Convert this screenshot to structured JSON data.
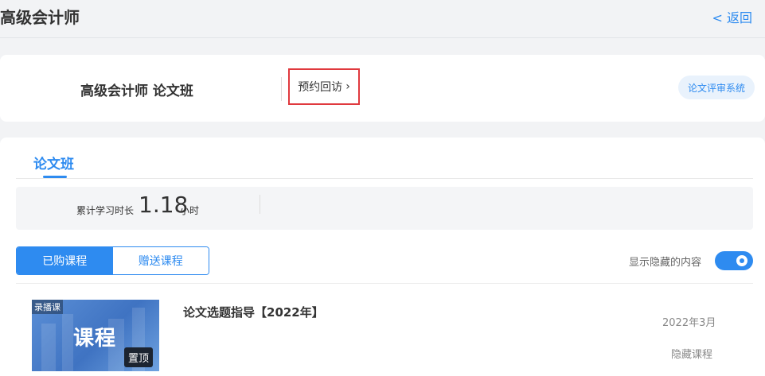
{
  "header": {
    "title": "高级会计师",
    "back_label": "< 返回"
  },
  "course_card": {
    "name": "高级会计师 论文班",
    "appoint_label": "预约回访",
    "review_label": "论文评审系统"
  },
  "tabs": [
    {
      "label": "论文班",
      "active": true
    }
  ],
  "stats": {
    "label": "累计学习时长",
    "value": "1.18",
    "unit": "小时"
  },
  "segment": {
    "options": [
      "已购课程",
      "赠送课程"
    ],
    "selected": "已购课程"
  },
  "toggle": {
    "label": "显示隐藏的内容",
    "on": true
  },
  "courses": [
    {
      "thumb_tag": "录播课",
      "thumb_word": "课程",
      "pin_label": "置顶",
      "title": "论文选题指导【2022年】",
      "date": "2022年3月",
      "hide_label": "隐藏课程"
    }
  ],
  "colors": {
    "accent": "#2e8bf0",
    "highlight_box": "#e0393e"
  }
}
